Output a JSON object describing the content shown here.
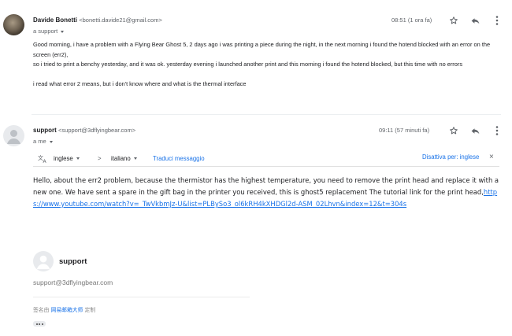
{
  "message1": {
    "sender_name": "Davide Bonetti",
    "sender_email": "<bonetti.davide21@gmail.com>",
    "to_label": "a support",
    "time": "08:51 (1 ora fa)",
    "body_lines": [
      "Good morning, i have a problem with a Flying Bear Ghost 5, 2 days ago i was printing a piece during the night, in the next morning i found the hotend blocked with an error on the screen (err2),",
      "so i tried to print a benchy yesterday, and it was ok. yesterday evening i launched another print and this morning i found the hotend blocked, but this time with no errors",
      "",
      "i read what error 2 means, but i don't know where and what is the thermal interface"
    ]
  },
  "message2": {
    "sender_name": "support",
    "sender_email": "<support@3dflyingbear.com>",
    "to_label": "a me",
    "time": "09:11 (57 minuti fa)",
    "translate": {
      "from_lang": "inglese",
      "to_lang": "italiano",
      "translate_link": "Traduci messaggio",
      "disable_link": "Disattiva per: inglese",
      "arrow": ">",
      "close": "×"
    },
    "body_text": "Hello, about the err2 problem, because the thermistor has the highest temperature, you need to remove the print head and replace it with a new one. We have sent a spare in the gift bag in the printer you received, this is ghost5 replacement The tutorial link for the print head,",
    "body_link": "https://www.youtube.com/watch?v=_TwVkbmJz-U&list=PLBySo3_ol6kRH4kXHDGl2d-ASM_02Lhvn&index=12&t=304s",
    "signature": {
      "name": "support",
      "email": "support@3dflyingbear.com",
      "footer_prefix": "签名由",
      "footer_link": "网易邮箱大师",
      "footer_suffix": "定制"
    }
  }
}
